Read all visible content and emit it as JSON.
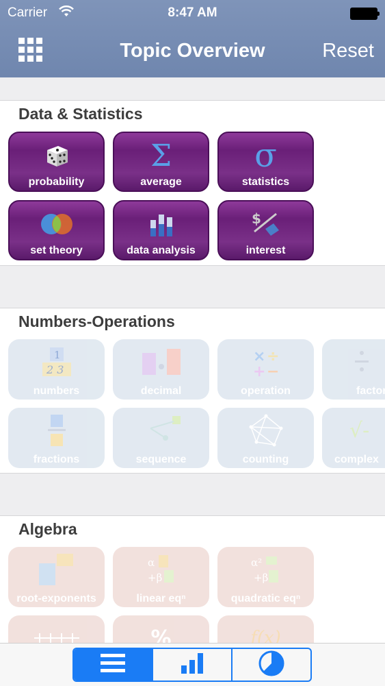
{
  "status_bar": {
    "carrier": "Carrier",
    "time": "8:47 AM"
  },
  "nav": {
    "title": "Topic Overview",
    "reset_label": "Reset"
  },
  "sections": [
    {
      "title": "Data & Statistics",
      "tiles": [
        "probability",
        "average",
        "statistics",
        "set theory",
        "data analysis",
        "interest"
      ]
    },
    {
      "title": "Numbers-Operations",
      "tiles": [
        "numbers",
        "decimal",
        "operation",
        "factor",
        "fractions",
        "sequence",
        "counting",
        "complex"
      ]
    },
    {
      "title": "Algebra",
      "tiles": [
        "root-exponents",
        "linear eqⁿ",
        "quadratic eqⁿ",
        "",
        "",
        ""
      ]
    }
  ],
  "icons": {
    "average": "Σ",
    "statistics": "σ",
    "numbers": "1 2 3",
    "operation": "×÷",
    "complex": "√-",
    "quadratic": "α² +β",
    "linear": "α +β",
    "percent": "%",
    "function": "f(x)"
  },
  "colors": {
    "accent": "#1a7cf5",
    "nav": "#7289b1",
    "stat_tile": "#7a2c88"
  },
  "tabbar": {
    "items": [
      "list-icon",
      "bar-chart-icon",
      "pie-chart-icon"
    ],
    "active_index": 0
  }
}
